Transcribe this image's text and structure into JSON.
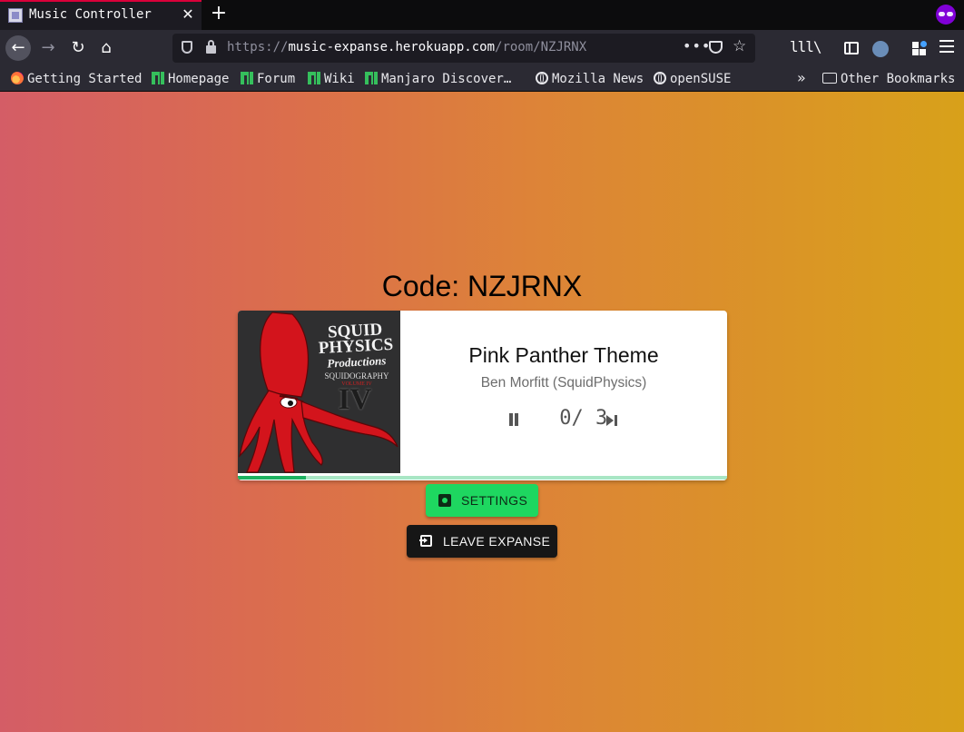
{
  "browser": {
    "tab": {
      "title": "Music Controller",
      "close_glyph": "✕"
    },
    "new_tab_glyph": "+",
    "url": {
      "scheme": "https://",
      "host": "music-expanse.herokuapp.com",
      "path": "/room/NZJRNX",
      "more_glyph": "•••",
      "star_glyph": "☆"
    },
    "nav": {
      "back_glyph": "←",
      "forward_glyph": "→",
      "reload_glyph": "↻",
      "home_glyph": "⌂",
      "library_glyph": "lll\\"
    },
    "bookmarks": [
      {
        "label": "Getting Started",
        "icon": "firefox-icon"
      },
      {
        "label": "Homepage",
        "icon": "manjaro-icon"
      },
      {
        "label": "Forum",
        "icon": "manjaro-icon"
      },
      {
        "label": "Wiki",
        "icon": "manjaro-icon"
      },
      {
        "label": "Manjaro Discover…",
        "icon": "manjaro-icon"
      },
      {
        "label": "Mozilla News",
        "icon": "globe-icon"
      },
      {
        "label": "openSUSE",
        "icon": "globe-icon"
      }
    ],
    "bookmarks_overflow_glyph": "»",
    "other_bookmarks": "Other Bookmarks",
    "accent_color": "#d9003a",
    "private_color": "#8000d7"
  },
  "room": {
    "code_label": "Code: NZJRNX"
  },
  "player": {
    "album_art": {
      "logo_line1": "SQUID",
      "logo_line2": "PHYSICS",
      "logo_line3": "Productions",
      "subtitle": "SQUIDOGRAPHY",
      "volume_label": "VOLUME IV",
      "volume_numeral": "IV"
    },
    "title": "Pink Panther Theme",
    "artist": "Ben Morfitt (SquidPhysics)",
    "votes_text": " 0/ 3",
    "progress": 0.14,
    "progress_color": "#1db260"
  },
  "actions": {
    "settings_label": "SETTINGS",
    "leave_label": "LEAVE EXPANSE",
    "settings_color": "#1ed760"
  }
}
